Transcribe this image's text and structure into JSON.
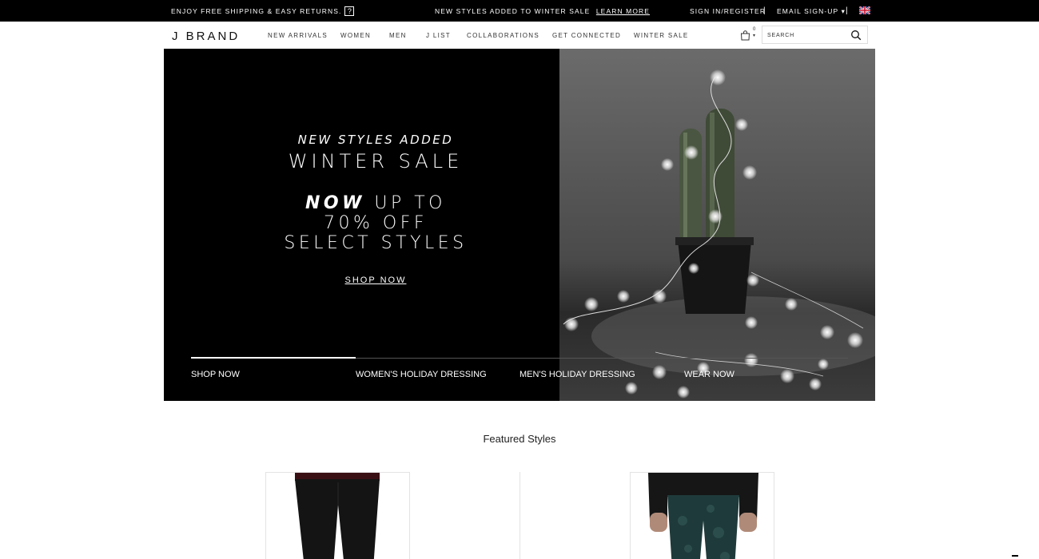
{
  "topbar": {
    "shipping_text": "ENJOY FREE SHIPPING & EASY RETURNS.",
    "help_icon_label": "?",
    "promo_text": "NEW STYLES ADDED TO WINTER SALE",
    "promo_link": "LEARN MORE",
    "sign_in": "SIGN IN/REGISTER",
    "separator": "|",
    "email_signup": "EMAIL SIGN-UP ▾",
    "flag_icon": "uk-flag-icon"
  },
  "nav": {
    "logo": "J BRAND",
    "items": [
      "NEW ARRIVALS",
      "WOMEN",
      "MEN",
      "J LIST",
      "COLLABORATIONS",
      "GET CONNECTED",
      "WINTER SALE"
    ],
    "cart_count": "0",
    "cart_icon": "shopping-bag-icon",
    "search_placeholder": "SEARCH",
    "search_icon": "search-icon"
  },
  "hero": {
    "kicker": "NEW STYLES ADDED",
    "title": "WINTER SALE",
    "offer_em": "NOW",
    "offer_line1_rest": " UP TO",
    "offer_line2": "70% OFF",
    "offer_line3": "SELECT STYLES",
    "cta": "SHOP NOW",
    "slides": [
      "SHOP NOW",
      "WOMEN'S HOLIDAY DRESSING",
      "MEN'S HOLIDAY DRESSING",
      "WEAR NOW"
    ],
    "active_slide": 0
  },
  "featured": {
    "title": "Featured Styles"
  },
  "colors": {
    "black": "#000000",
    "white": "#ffffff",
    "border": "#e3e3e3"
  }
}
